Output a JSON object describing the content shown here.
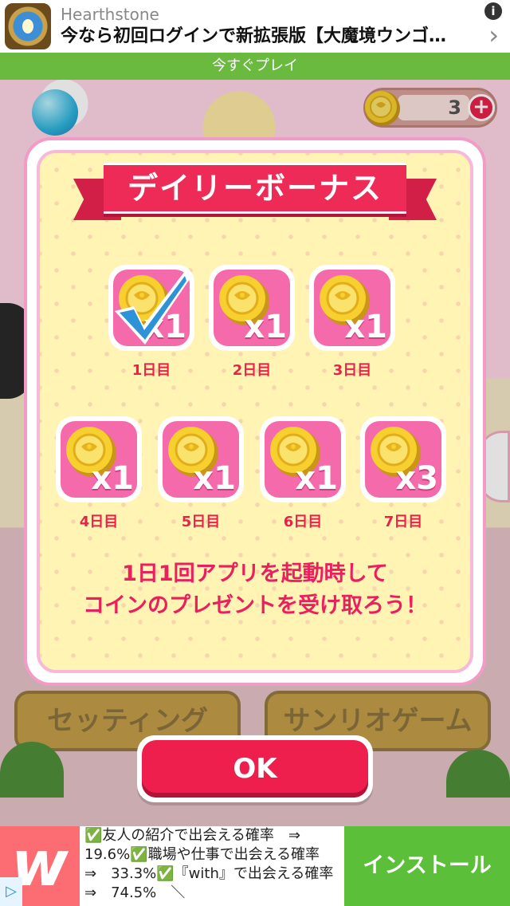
{
  "ad_top": {
    "brand": "Hearthstone",
    "headline": "今なら初回ログインで新拡張版【大魔境ウンゴ…",
    "info": "i",
    "chevron": "›",
    "cta": "今すぐプレイ"
  },
  "coin_counter": {
    "count": "3",
    "plus": "+"
  },
  "background_buttons": {
    "settings": "セッティング",
    "sanrio_game": "サンリオゲーム"
  },
  "dialog": {
    "title": "デイリーボーナス",
    "days": [
      {
        "label": "1日目",
        "multiplier": "x1",
        "claimed": true
      },
      {
        "label": "2日目",
        "multiplier": "x1",
        "claimed": false
      },
      {
        "label": "3日目",
        "multiplier": "x1",
        "claimed": false
      },
      {
        "label": "4日目",
        "multiplier": "x1",
        "claimed": false
      },
      {
        "label": "5日目",
        "multiplier": "x1",
        "claimed": false
      },
      {
        "label": "6日目",
        "multiplier": "x1",
        "claimed": false
      },
      {
        "label": "7日目",
        "multiplier": "x3",
        "claimed": false
      }
    ],
    "message_line1": "1日1回アプリを起動時して",
    "message_line2": "コインのプレゼントを受け取ろう！",
    "ok": "OK"
  },
  "ad_bottom": {
    "logo": "w",
    "text": "✅友人の紹介で出会える確率　⇒　19.6%✅職場や仕事で出会える確率　⇒　33.3%✅『with』で出会える確率　⇒　74.5%　＼",
    "install": "インストール",
    "adchoice": "▷"
  },
  "colors": {
    "accent": "#ee1f4d",
    "ribbon": "#ee2b56",
    "tile": "#f56aaa",
    "dialog_bg": "#fff4b4",
    "cta_green": "#6aba3f"
  }
}
